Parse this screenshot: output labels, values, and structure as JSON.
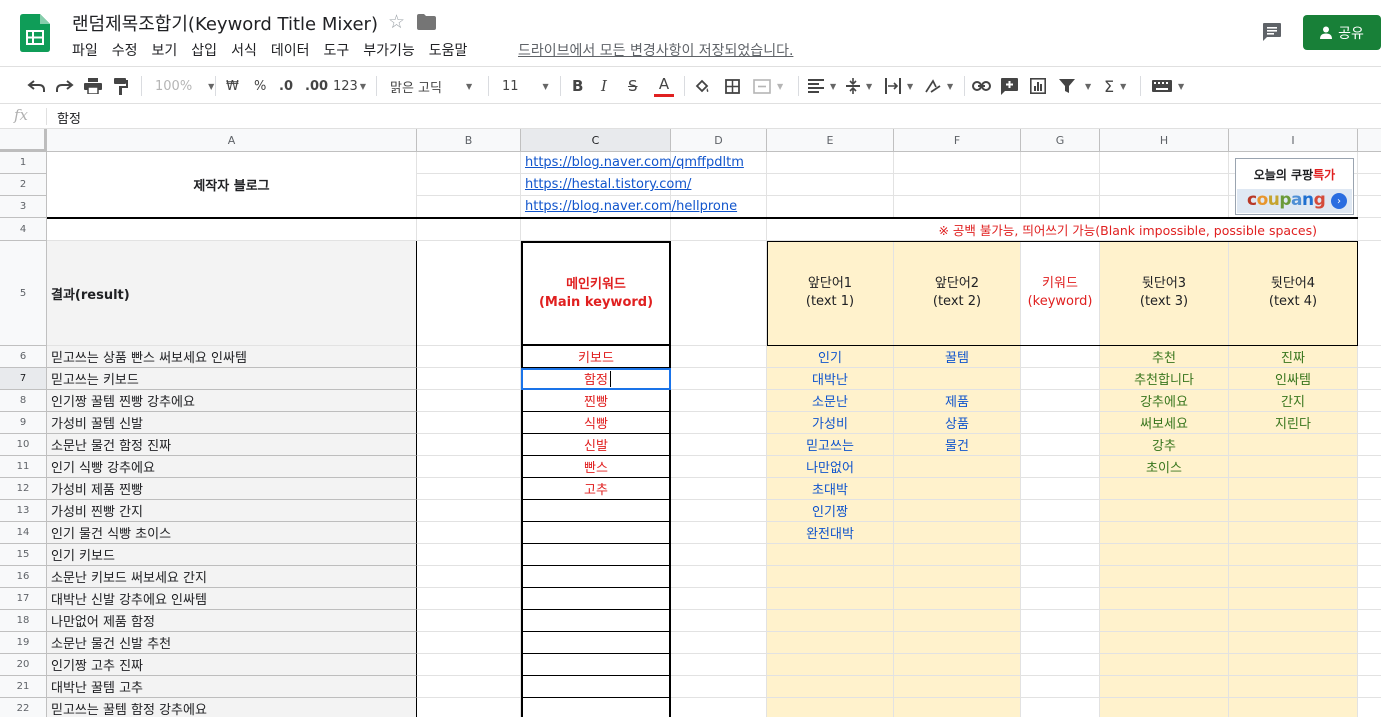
{
  "doc": {
    "title": "랜덤제목조합기(Keyword Title Mixer)",
    "save_status": "드라이브에서 모든 변경사항이 저장되었습니다.",
    "share_label": "공유"
  },
  "menu": [
    "파일",
    "수정",
    "보기",
    "삽입",
    "서식",
    "데이터",
    "도구",
    "부가기능",
    "도움말"
  ],
  "toolbar": {
    "zoom": "100%",
    "currency": "₩",
    "percent": "%",
    "decrease_decimal": ".0",
    "increase_decimal": ".00",
    "more_formats": "123",
    "font_name": "맑은 고딕",
    "font_size": "11",
    "bold": "B",
    "italic": "I",
    "strike": "S",
    "text_color": "A",
    "sigma": "Σ"
  },
  "formula_bar": {
    "fx": "fx",
    "value": "함정"
  },
  "columns": [
    "A",
    "B",
    "C",
    "D",
    "E",
    "F",
    "G",
    "H",
    "I"
  ],
  "selected_column": "C",
  "row_numbers": [
    "1",
    "2",
    "3",
    "4",
    "5",
    "6",
    "7",
    "8",
    "9",
    "10",
    "11",
    "12",
    "13",
    "14",
    "15",
    "16",
    "17",
    "18",
    "19",
    "20",
    "21",
    "22"
  ],
  "selected_row": "7",
  "sheet": {
    "creator_label": "제작자 블로그",
    "links": [
      "https://blog.naver.com/qmffpdltm",
      "https://hestal.tistory.com/",
      "https://blog.naver.com/hellprone"
    ],
    "notice": "※ 공백 불가능, 띄어쓰기 가능(Blank impossible, possible spaces)",
    "headers": {
      "result": "결과(result)",
      "main_kw_1": "메인키워드",
      "main_kw_2": "(Main keyword)",
      "e1": "앞단어1",
      "e2": "(text 1)",
      "f1": "앞단어2",
      "f2": "(text 2)",
      "g1": "키워드",
      "g2": "(keyword)",
      "h1": "뒷단어3",
      "h2": "(text 3)",
      "i1": "뒷단어4",
      "i2": "(text 4)"
    },
    "results": [
      "믿고쓰는 상품 빤스 써보세요 인싸템",
      "믿고쓰는   키보드",
      "인기짱 꿀템 찐빵 강추에요",
      "가성비 꿀템 신발",
      "소문난 물건 함정  진짜",
      "인기   식빵 강추에요",
      "가성비 제품 찐빵",
      "가성비   찐빵   간지",
      "인기 물건 식빵 초이스",
      "인기   키보드",
      "소문난   키보드 써보세요 간지",
      "대박난   신발 강추에요 인싸템",
      "나만없어 제품 함정",
      "소문난 물건 신발 추천",
      "인기짱   고추   진짜",
      "대박난 꿀템 고추",
      "믿고쓰는 꿀템 함정 강추에요"
    ],
    "main_keywords": [
      "키보드",
      "함정",
      "찐빵",
      "식빵",
      "신발",
      "빤스",
      "고추"
    ],
    "text1": [
      "인기",
      "대박난",
      "소문난",
      "가성비",
      "믿고쓰는",
      "나만없어",
      "초대박",
      "인기짱",
      "완전대박"
    ],
    "text2": [
      "꿀템",
      "",
      "제품",
      "상품",
      "물건"
    ],
    "text3": [
      "추천",
      "추천합니다",
      "강추에요",
      "써보세요",
      "강추",
      "초이스"
    ],
    "text4": [
      "진짜",
      "인싸템",
      "간지",
      "지린다"
    ]
  },
  "ad": {
    "top_text": "오늘의 쿠팡",
    "top_highlight": "특가",
    "logo_letters": [
      "c",
      "o",
      "u",
      "p",
      "a",
      "n",
      "g"
    ],
    "logo_colors": [
      "#b93827",
      "#e8962e",
      "#c5a430",
      "#6b9b39",
      "#4f8fd5",
      "#1f6fd0",
      "#d44b3b"
    ],
    "go_icon": "›"
  },
  "colors": {
    "accent_green": "#188038",
    "keyword_red": "#e02020",
    "text1_blue": "#1155cc",
    "text3_green": "#38761d",
    "highlight_yellow": "#fff2cc",
    "selection_blue": "#1a73e8"
  }
}
